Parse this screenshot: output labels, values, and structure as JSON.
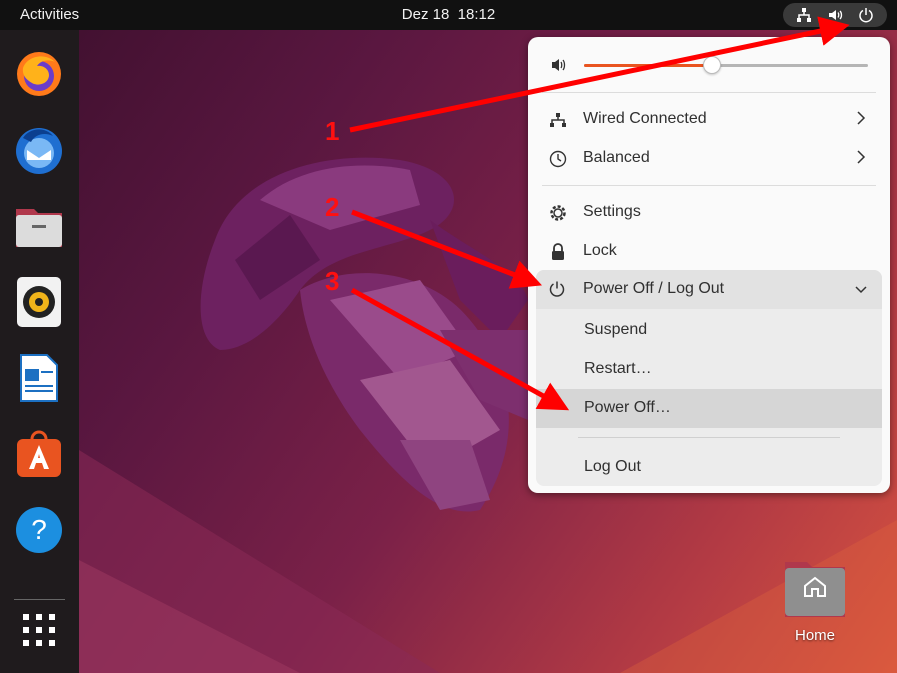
{
  "topbar": {
    "activities": "Activities",
    "clock": "Dez 18  18:12",
    "status_icons": [
      "network-wired-icon",
      "volume-icon",
      "power-icon"
    ]
  },
  "dock": {
    "items": [
      "firefox-icon",
      "thunderbird-icon",
      "files-icon",
      "rhythmbox-icon",
      "libreoffice-writer-icon",
      "software-center-icon",
      "help-icon"
    ],
    "apps_grid": "show-applications-icon"
  },
  "desktop": {
    "home_label": "Home"
  },
  "menu": {
    "volume_level": 0.45,
    "wired": "Wired Connected",
    "power_mode": "Balanced",
    "settings": "Settings",
    "lock": "Lock",
    "power_off_logout": "Power Off / Log Out",
    "suspend": "Suspend",
    "restart": "Restart…",
    "power_off": "Power Off…",
    "log_out": "Log Out"
  },
  "annotations": {
    "step1": "1",
    "step2": "2",
    "step3": "3",
    "arrow_color": "#ff0000"
  },
  "colors": {
    "accent": "#e95420",
    "topbar": "#111111",
    "dock": "#1f1b1d",
    "menu_bg": "#fafafa"
  }
}
